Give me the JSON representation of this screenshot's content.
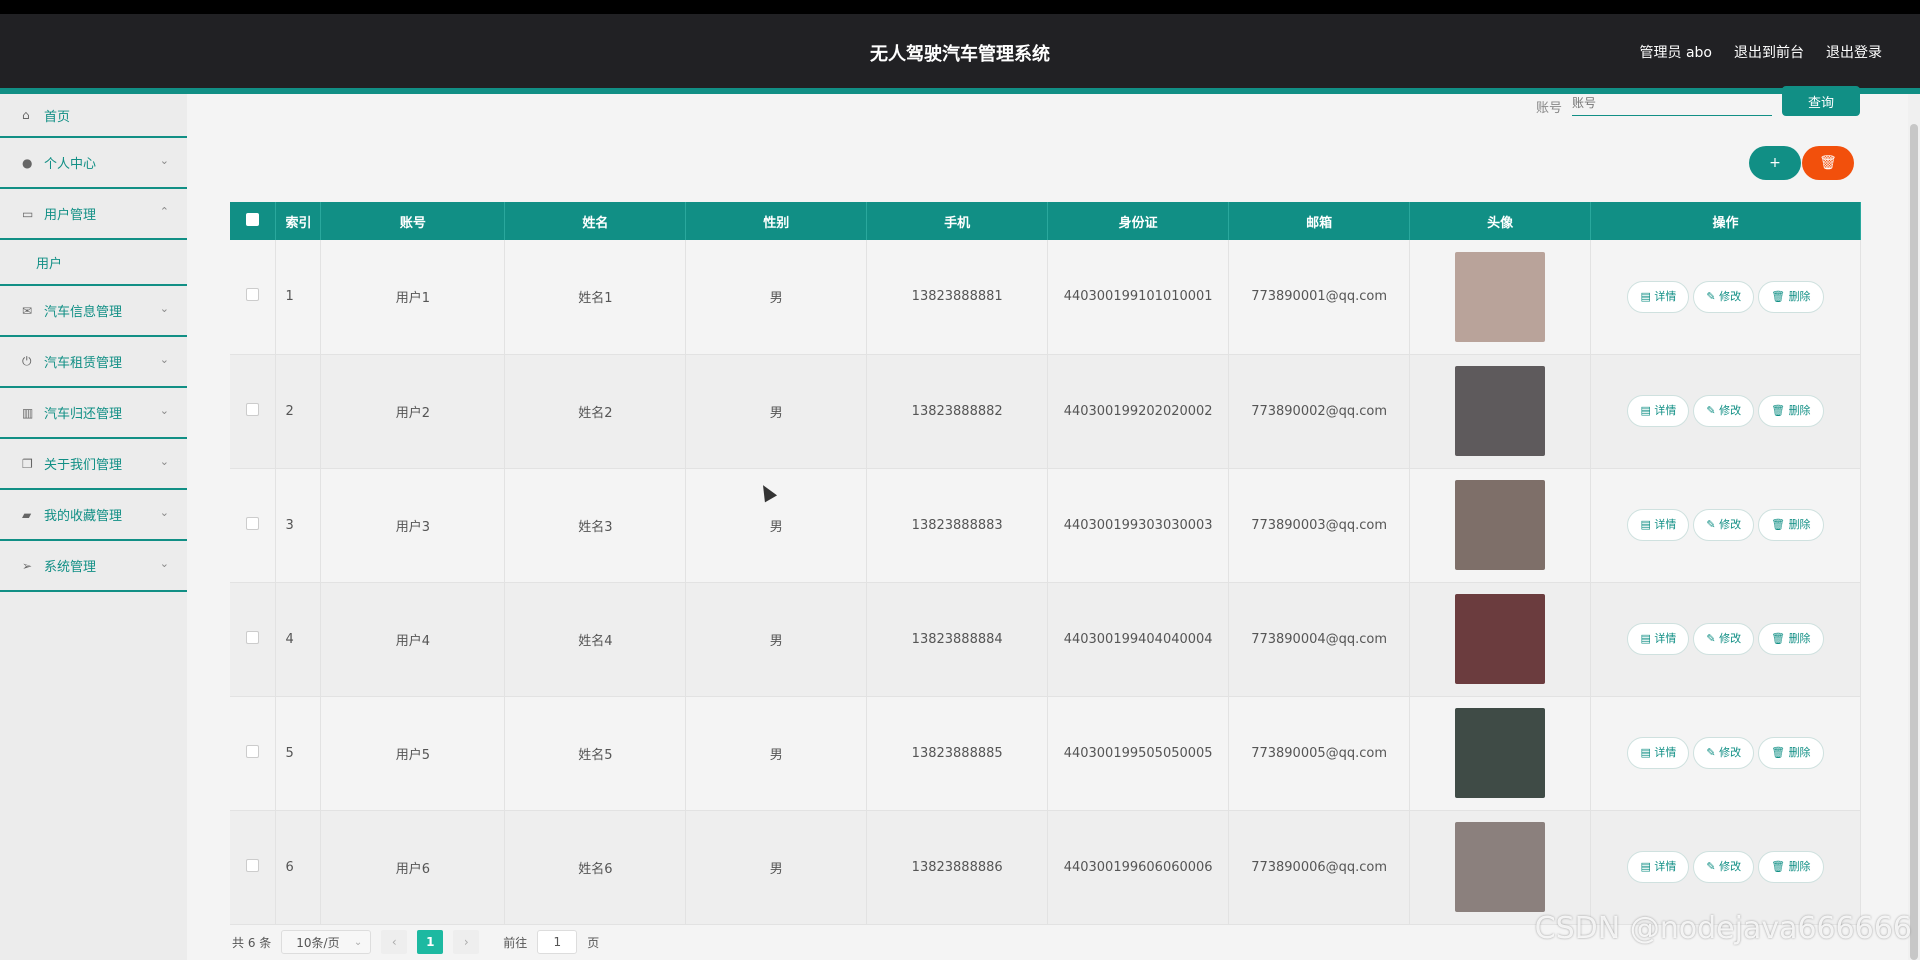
{
  "header": {
    "title": "无人驾驶汽车管理系统",
    "admin_label": "管理员 abo",
    "to_front_label": "退出到前台",
    "logout_label": "退出登录"
  },
  "sidebar": {
    "items": [
      {
        "label": "首页",
        "icon": "home-icon"
      },
      {
        "label": "个人中心",
        "icon": "user-icon"
      },
      {
        "label": "用户管理",
        "icon": "chat-icon"
      },
      {
        "label": "用户",
        "icon": ""
      },
      {
        "label": "汽车信息管理",
        "icon": "mail-icon"
      },
      {
        "label": "汽车租赁管理",
        "icon": "power-icon"
      },
      {
        "label": "汽车归还管理",
        "icon": "bars-icon"
      },
      {
        "label": "关于我们管理",
        "icon": "copy-icon"
      },
      {
        "label": "我的收藏管理",
        "icon": "ticket-icon"
      },
      {
        "label": "系统管理",
        "icon": "send-icon"
      }
    ]
  },
  "search": {
    "label": "账号",
    "placeholder": "账号",
    "button_label": "查询"
  },
  "actions": {
    "add_label": "+",
    "delete_label": "🗑"
  },
  "table": {
    "headers": [
      "索引",
      "账号",
      "姓名",
      "性别",
      "手机",
      "身份证",
      "邮箱",
      "头像",
      "操作"
    ],
    "rows": [
      {
        "index": "1",
        "account": "用户1",
        "name": "姓名1",
        "gender": "男",
        "phone": "13823888881",
        "id_card": "440300199101010001",
        "email": "773890001@qq.com",
        "avatar_color": "#b9a39a"
      },
      {
        "index": "2",
        "account": "用户2",
        "name": "姓名2",
        "gender": "男",
        "phone": "13823888882",
        "id_card": "440300199202020002",
        "email": "773890002@qq.com",
        "avatar_color": "#5e5a5c"
      },
      {
        "index": "3",
        "account": "用户3",
        "name": "姓名3",
        "gender": "男",
        "phone": "13823888883",
        "id_card": "440300199303030003",
        "email": "773890003@qq.com",
        "avatar_color": "#7e6f69"
      },
      {
        "index": "4",
        "account": "用户4",
        "name": "姓名4",
        "gender": "男",
        "phone": "13823888884",
        "id_card": "440300199404040004",
        "email": "773890004@qq.com",
        "avatar_color": "#6b3c3e"
      },
      {
        "index": "5",
        "account": "用户5",
        "name": "姓名5",
        "gender": "男",
        "phone": "13823888885",
        "id_card": "440300199505050005",
        "email": "773890005@qq.com",
        "avatar_color": "#3f4b46"
      },
      {
        "index": "6",
        "account": "用户6",
        "name": "姓名6",
        "gender": "男",
        "phone": "13823888886",
        "id_card": "440300199606060006",
        "email": "773890006@qq.com",
        "avatar_color": "#8b807d"
      }
    ],
    "row_actions": {
      "detail": "详情",
      "edit": "修改",
      "delete": "删除"
    }
  },
  "pagination": {
    "total": "共 6 条",
    "page_size": "10条/页",
    "current_page": "1",
    "goto_label": "前往",
    "goto_value": "1",
    "page_suffix": "页"
  },
  "watermark": "CSDN @nodejava666666",
  "colors": {
    "accent": "#118f85",
    "danger": "#f2500c",
    "header_bg": "#212124"
  }
}
